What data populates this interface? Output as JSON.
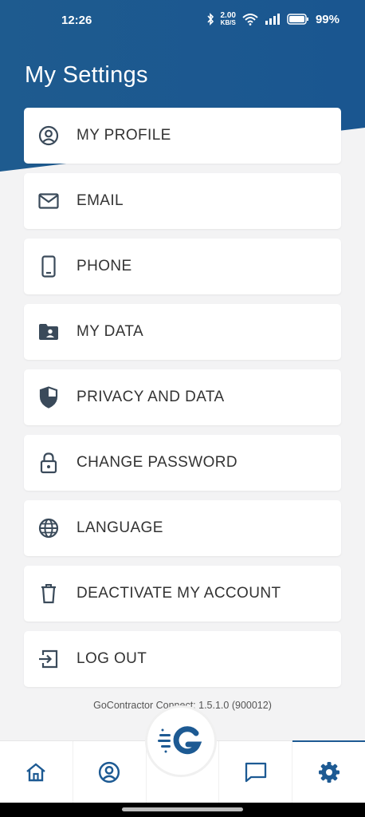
{
  "status_bar": {
    "time": "12:26",
    "net_speed_value": "2.00",
    "net_speed_unit": "KB/S",
    "battery": "99%"
  },
  "page": {
    "title": "My Settings"
  },
  "menu": {
    "items": [
      {
        "label": "MY PROFILE",
        "icon": "profile-icon"
      },
      {
        "label": "EMAIL",
        "icon": "email-icon"
      },
      {
        "label": "PHONE",
        "icon": "phone-icon"
      },
      {
        "label": "MY DATA",
        "icon": "folder-user-icon"
      },
      {
        "label": "PRIVACY AND DATA",
        "icon": "shield-icon"
      },
      {
        "label": "CHANGE PASSWORD",
        "icon": "lock-icon"
      },
      {
        "label": "LANGUAGE",
        "icon": "globe-icon"
      },
      {
        "label": "DEACTIVATE MY ACCOUNT",
        "icon": "trash-icon"
      },
      {
        "label": "LOG OUT",
        "icon": "logout-icon"
      }
    ]
  },
  "footer": {
    "version": "GoContractor Connect: 1.5.1.0 (900012)"
  },
  "bottom_nav": {
    "items": [
      "home-icon",
      "profile-icon",
      "gocontractor-logo",
      "chat-icon",
      "settings-icon"
    ],
    "active": "settings-icon"
  },
  "colors": {
    "primary": "#1d5a93",
    "icon": "#3a4a5a",
    "background": "#f3f3f4"
  }
}
